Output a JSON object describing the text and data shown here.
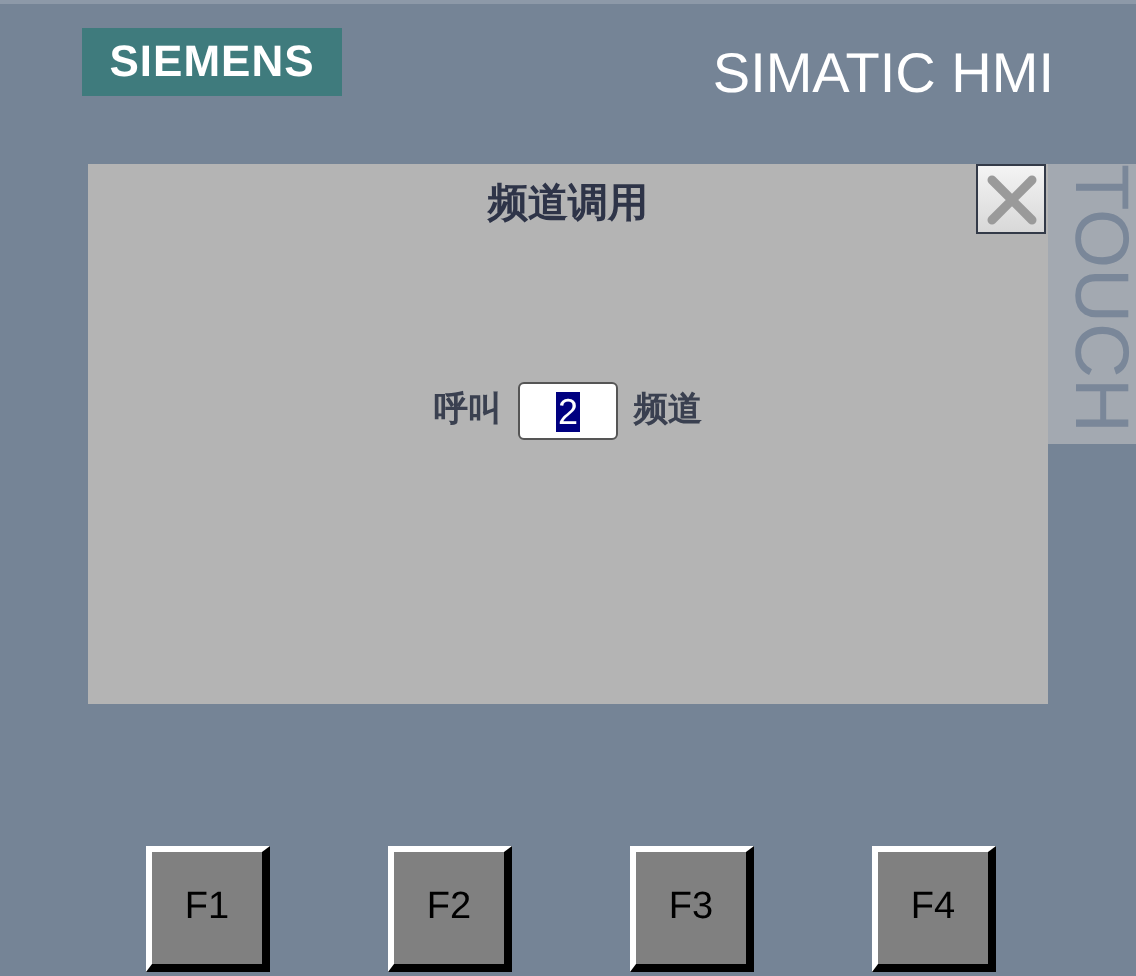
{
  "header": {
    "logo": "SIEMENS",
    "product": "SIMATIC HMI"
  },
  "dialog": {
    "title": "频道调用",
    "prompt_label": "呼叫",
    "field": {
      "value": "2",
      "selected": true
    },
    "unit_label": "频道"
  },
  "side_label": "TOUCH",
  "function_keys": [
    {
      "label": "F1"
    },
    {
      "label": "F2"
    },
    {
      "label": "F3"
    },
    {
      "label": "F4"
    }
  ]
}
